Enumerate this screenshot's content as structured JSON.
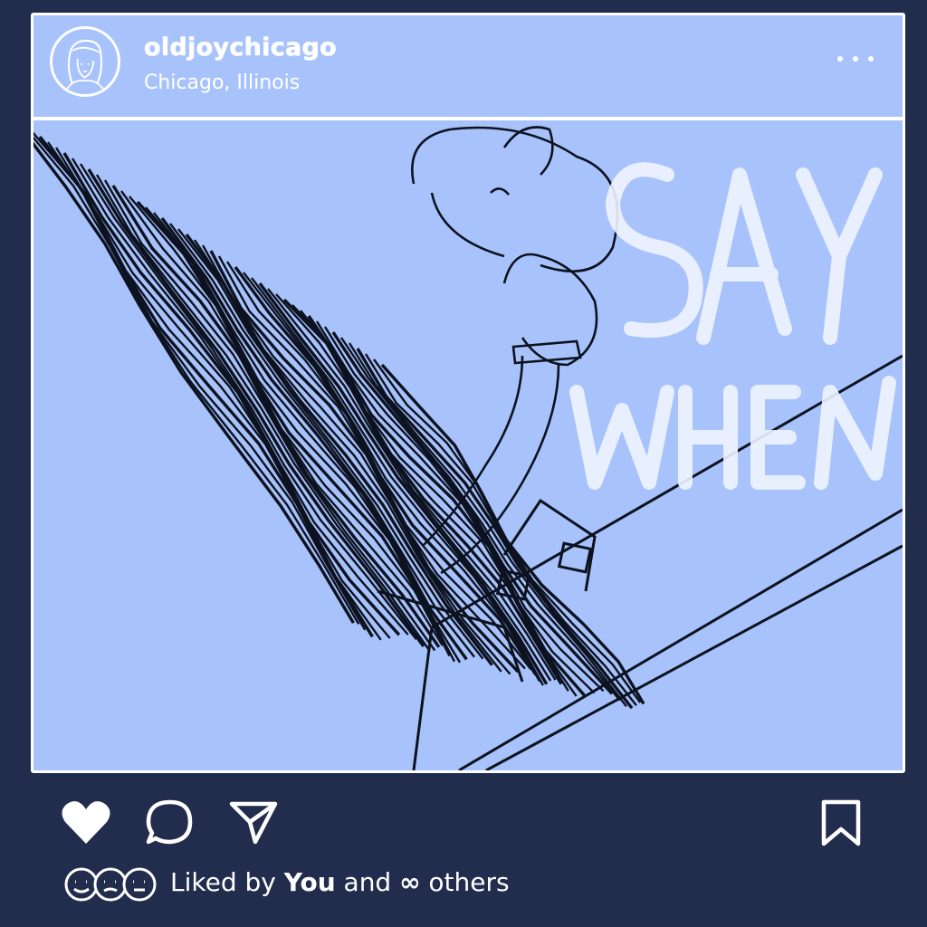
{
  "post": {
    "username": "oldjoychicago",
    "location": "Chicago, Illinois",
    "more_label": "more options",
    "artwork_text": "SAY WHEN",
    "likes": {
      "prefix": "Liked by",
      "user": "You",
      "middle": "and",
      "count_symbol": "∞",
      "suffix": "others"
    }
  },
  "icons": {
    "avatar": "avatar-sketch-icon",
    "more": "ellipsis-icon",
    "like": "heart-icon",
    "comment": "comment-bubble-icon",
    "share": "paper-plane-icon",
    "save": "bookmark-icon",
    "likers": "smiley-faces-icon"
  },
  "colors": {
    "background": "#222d4d",
    "card": "#a8c3fb",
    "line": "#ffffff",
    "ink": "#0d1220"
  }
}
